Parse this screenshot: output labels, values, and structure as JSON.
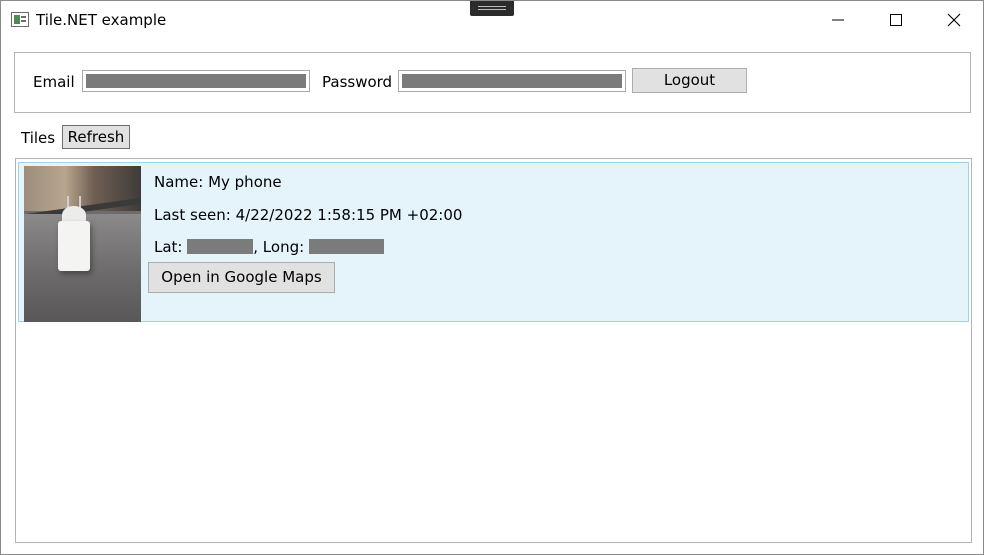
{
  "window": {
    "title": "Tile.NET example",
    "controls": {
      "minimize_icon": "minimize-icon",
      "maximize_icon": "maximize-icon",
      "close_icon": "close-icon"
    }
  },
  "login": {
    "email_label": "Email",
    "email_value": "",
    "password_label": "Password",
    "password_value": "",
    "logout_label": "Logout"
  },
  "tiles": {
    "label": "Tiles",
    "refresh_label": "Refresh",
    "items": [
      {
        "name": "Name: My phone",
        "last_seen": "Last seen: 4/22/2022 1:58:15 PM +02:00",
        "lat_label": "Lat:",
        "long_label": ", Long:",
        "open_maps_label": "Open in Google Maps"
      }
    ]
  },
  "colors": {
    "selection_background": "#e5f3fb",
    "selection_border": "#9fd3ec",
    "button_background": "#e1e1e1",
    "redaction": "#7b7b7b"
  }
}
